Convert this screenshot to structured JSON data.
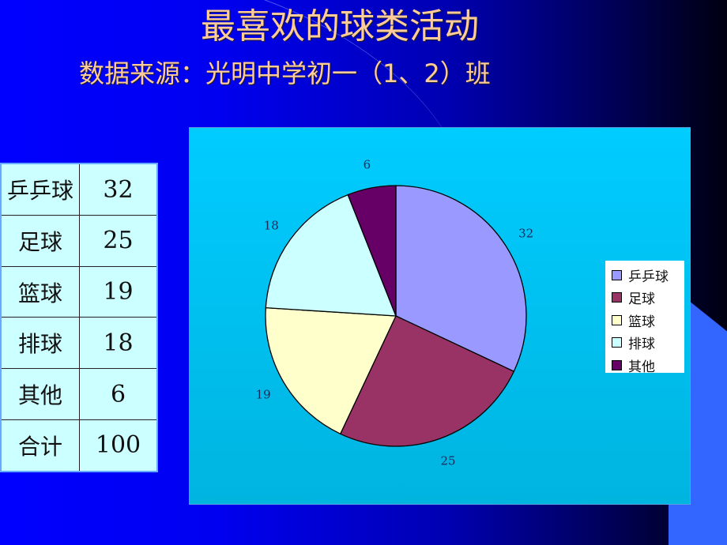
{
  "slide": {
    "title": "最喜欢的球类活动",
    "subtitle": "数据来源：光明中学初一（1、2）班"
  },
  "table": {
    "rows": [
      {
        "name": "乒乒球",
        "value": "32"
      },
      {
        "name": "足球",
        "value": "25"
      },
      {
        "name": "篮球",
        "value": "19"
      },
      {
        "name": "排球",
        "value": "18"
      },
      {
        "name": "其他",
        "value": "6"
      },
      {
        "name": "合计",
        "value": "100"
      }
    ]
  },
  "chart_data": {
    "type": "pie",
    "title": "",
    "categories": [
      "乒乒球",
      "足球",
      "篮球",
      "排球",
      "其他"
    ],
    "values": [
      32,
      25,
      19,
      18,
      6
    ],
    "data_labels": [
      "32",
      "25",
      "19",
      "18",
      "6"
    ],
    "colors": [
      "#9999ff",
      "#993366",
      "#ffffcc",
      "#ccffff",
      "#660066"
    ],
    "start_angle": "12 o'clock",
    "direction": "clockwise",
    "legend": {
      "position": "right",
      "entries": [
        "乒乒球",
        "足球",
        "篮球",
        "排球",
        "其他"
      ]
    }
  }
}
